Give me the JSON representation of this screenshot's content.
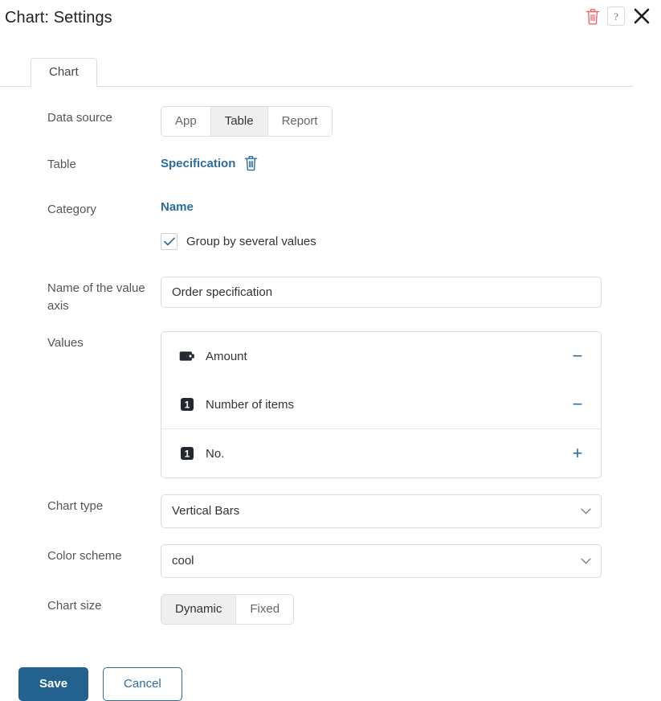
{
  "header": {
    "title": "Chart: Settings",
    "delete_icon": "trash-icon",
    "help_icon": "help-question-icon",
    "close_icon": "close-icon"
  },
  "tabs": [
    {
      "label": "Chart",
      "active": true
    }
  ],
  "form": {
    "data_source": {
      "label": "Data source",
      "options": [
        "App",
        "Table",
        "Report"
      ],
      "selected": "Table"
    },
    "table": {
      "label": "Table",
      "value": "Specification",
      "delete_icon": "trash-icon"
    },
    "category": {
      "label": "Category",
      "value": "Name",
      "group_checkbox": {
        "label": "Group by several values",
        "checked": true,
        "icon": "check-icon"
      }
    },
    "value_axis": {
      "label": "Name of the value axis",
      "value": "Order specification",
      "placeholder": ""
    },
    "values": {
      "label": "Values",
      "items": [
        {
          "name": "Amount",
          "badge": "wallet-icon",
          "badge_text": "",
          "action": "minus",
          "divided": false
        },
        {
          "name": "Number of items",
          "badge": "number-field-icon",
          "badge_text": "1",
          "action": "minus",
          "divided": false
        },
        {
          "name": "No.",
          "badge": "number-field-icon",
          "badge_text": "1",
          "action": "plus",
          "divided": true
        }
      ]
    },
    "chart_type": {
      "label": "Chart type",
      "value": "Vertical Bars",
      "options": [
        "Vertical Bars"
      ],
      "icon": "chevron-down-icon"
    },
    "color_scheme": {
      "label": "Color scheme",
      "value": "cool",
      "options": [
        "cool"
      ],
      "icon": "chevron-down-icon"
    },
    "chart_size": {
      "label": "Chart size",
      "options": [
        "Dynamic",
        "Fixed"
      ],
      "selected": "Dynamic"
    }
  },
  "footer": {
    "save_label": "Save",
    "cancel_label": "Cancel"
  },
  "colors": {
    "link_blue": "#2c6c9e",
    "primary_blue": "#23628f",
    "delete_red": "#f2676b",
    "badge_dark": "#23272e",
    "label_gray": "#555555",
    "border_gray": "#dcdcdc",
    "segment_active": "#efefef"
  }
}
